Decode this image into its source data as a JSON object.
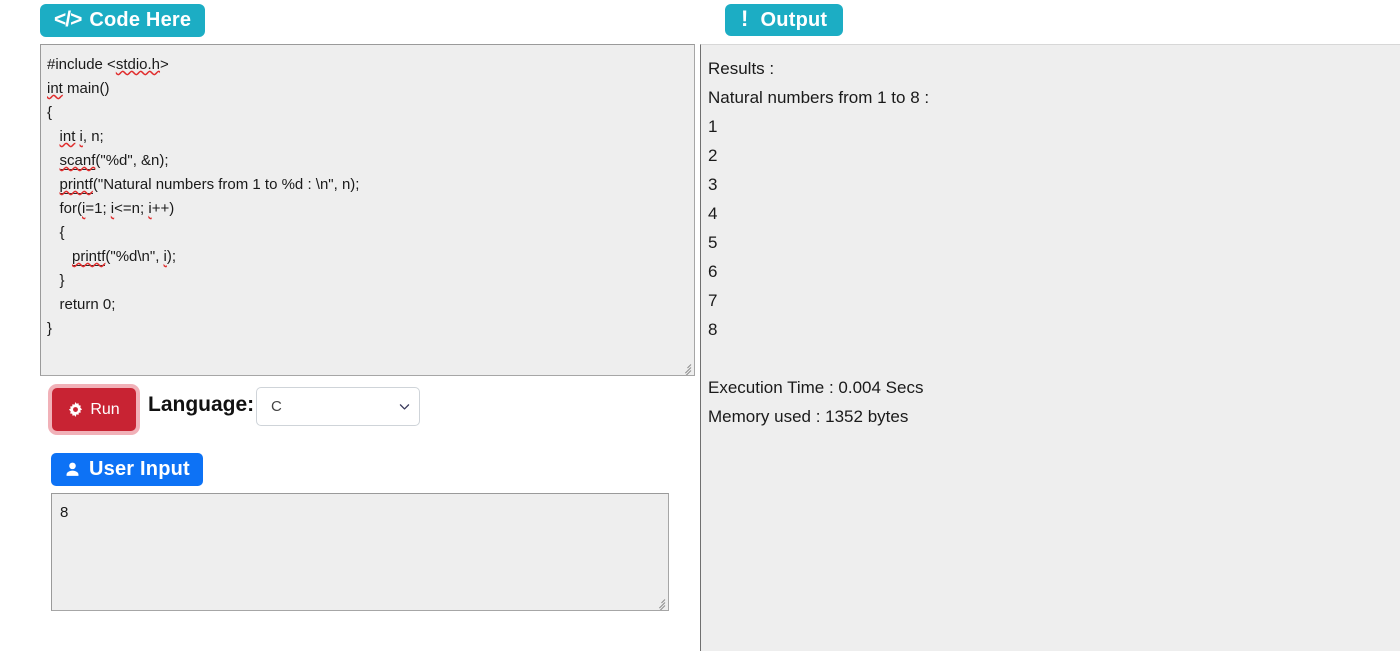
{
  "header": {
    "code_button_label": "Code Here",
    "code_button_icon": "code-tags-icon",
    "code_button_color": "#1cadc4",
    "output_button_label": "Output",
    "output_button_icon": "exclamation-icon",
    "output_button_color": "#1cadc4"
  },
  "editor": {
    "name": "code-editor",
    "code": "#include <stdio.h>\nint main()\n{\n   int i, n;\n   scanf(\"%d\", &n);\n   printf(\"Natural numbers from 1 to %d : \\n\", n);\n   for(i=1; i<=n; i++)\n   {\n      printf(\"%d\\n\", i);\n   }\n   return 0;\n}",
    "lines": [
      "#include <stdio.h>",
      "int main()",
      "{",
      "   int i, n;",
      "   scanf(\"%d\", &n);",
      "   printf(\"Natural numbers from 1 to %d : \\n\", n);",
      "   for(i=1; i<=n; i++)",
      "   {",
      "      printf(\"%d\\n\", i);",
      "   }",
      "   return 0;",
      "}"
    ]
  },
  "controls": {
    "run_label": "Run",
    "run_icon": "gear-icon",
    "run_color": "#c82333",
    "language_label": "Language:",
    "language_value": "C",
    "language_options": [
      "C"
    ],
    "chevron_icon": "chevron-down-icon"
  },
  "user_input": {
    "button_label": "User Input",
    "button_icon": "person-icon",
    "button_color": "#0d72f5",
    "value": "8"
  },
  "output": {
    "results_label": "Results :",
    "header_line": "Natural numbers from 1 to 8 :",
    "numbers": [
      "1",
      "2",
      "3",
      "4",
      "5",
      "6",
      "7",
      "8"
    ],
    "execution_time": "Execution Time : 0.004 Secs",
    "memory_used": "Memory used : 1352 bytes",
    "text": "Results :\nNatural numbers from 1 to 8 :\n1\n2\n3\n4\n5\n6\n7\n8\n\nExecution Time : 0.004 Secs\nMemory used : 1352 bytes"
  }
}
